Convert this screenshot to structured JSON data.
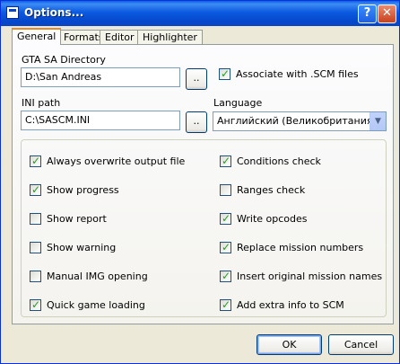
{
  "window": {
    "title": "Options...",
    "help_label": "?",
    "close_label": "✕"
  },
  "tabs": [
    {
      "label": "General"
    },
    {
      "label": "Formats"
    },
    {
      "label": "Editor"
    },
    {
      "label": "Highlighter"
    }
  ],
  "general": {
    "gta_dir_label": "GTA SA Directory",
    "gta_dir_value": "D:\\San Andreas",
    "browse_label": "..",
    "associate_label": "Associate with .SCM files",
    "ini_label": "INI path",
    "ini_value": "C:\\SASCM.INI",
    "language_label": "Language",
    "language_value": "Английский (Великобритания)"
  },
  "options_left": [
    {
      "label": "Always overwrite output file",
      "checked": true
    },
    {
      "label": "Show progress",
      "checked": true
    },
    {
      "label": "Show report",
      "checked": false
    },
    {
      "label": "Show warning",
      "checked": false
    },
    {
      "label": "Manual IMG opening",
      "checked": false
    },
    {
      "label": "Quick game loading",
      "checked": true
    }
  ],
  "options_right": [
    {
      "label": "Conditions check",
      "checked": true
    },
    {
      "label": "Ranges check",
      "checked": false
    },
    {
      "label": "Write opcodes",
      "checked": true
    },
    {
      "label": "Replace mission numbers",
      "checked": true
    },
    {
      "label": "Insert original mission names",
      "checked": true
    },
    {
      "label": "Add extra info to SCM",
      "checked": true
    }
  ],
  "associate_checked": true,
  "buttons": {
    "ok": "OK",
    "cancel": "Cancel"
  }
}
